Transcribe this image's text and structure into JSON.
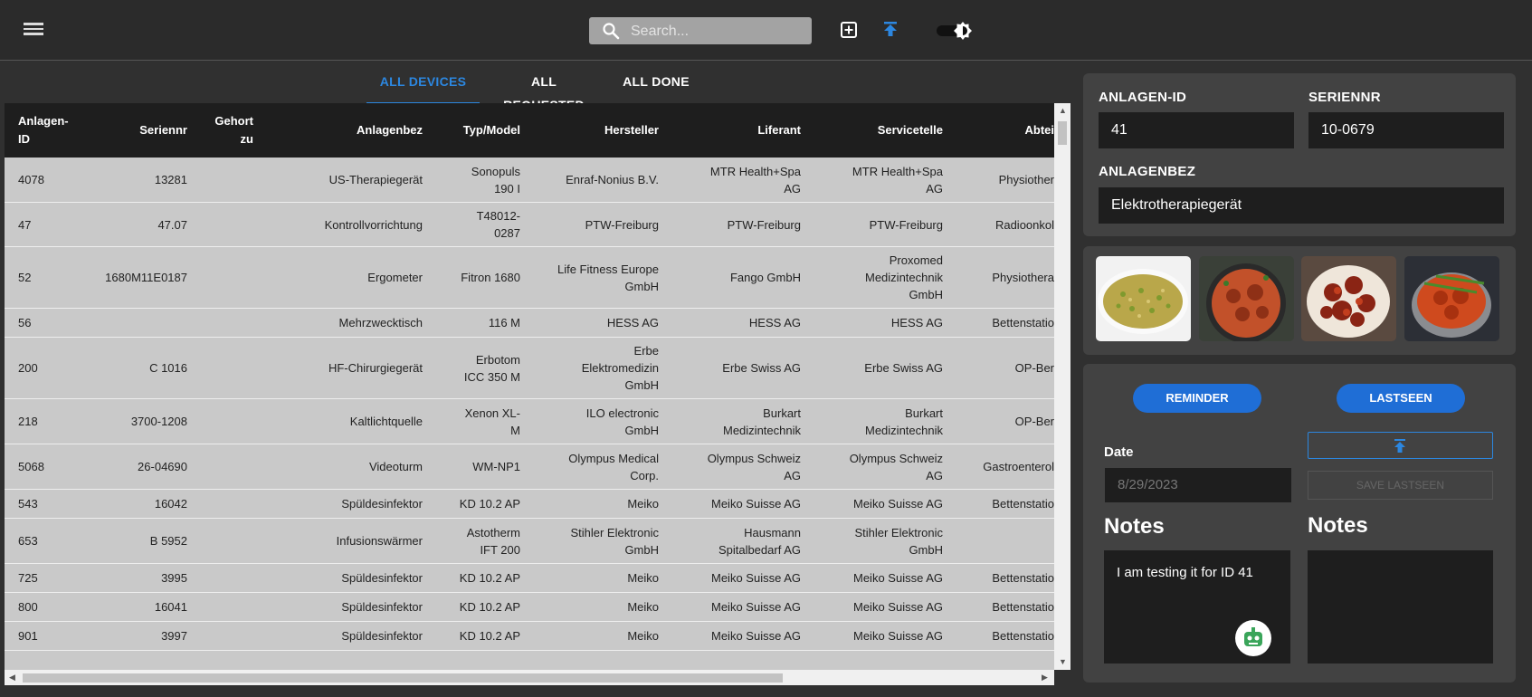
{
  "search": {
    "placeholder": "Search..."
  },
  "icons": {
    "menu": "menu-icon",
    "search": "search-icon",
    "add": "add-box-icon",
    "upload": "upload-icon",
    "theme": "theme-toggle-icon",
    "bot": "bot-icon"
  },
  "colors": {
    "accent": "#2c87e0",
    "button": "#1f6ed6",
    "topbar": "#2b2b2b",
    "panel": "#424242",
    "grid_bg": "#c9c9c9"
  },
  "tabs": [
    {
      "label": "ALL DEVICES",
      "active": true
    },
    {
      "label": "ALL REQUESTED",
      "active": false
    },
    {
      "label": "ALL DONE",
      "active": false
    }
  ],
  "table": {
    "headers": {
      "anlagen_id": [
        "Anlagen-",
        "ID"
      ],
      "seriennr": "Seriennr",
      "gehort_zu": [
        "Gehort",
        "zu"
      ],
      "anlagenbez": "Anlagenbez",
      "typ": "Typ/Model",
      "hersteller": "Hersteller",
      "liferant": "Liferant",
      "servicetelle": "Servicetelle",
      "abteilung": "Abtei"
    },
    "rows": [
      {
        "id": "4078",
        "serial": "13281",
        "bez": "US-Therapiegerät",
        "typ": [
          "Sonopuls",
          "190 I"
        ],
        "hersteller": [
          "Enraf-Nonius B.V."
        ],
        "liferant": [
          "MTR Health+Spa",
          "AG"
        ],
        "service": [
          "MTR Health+Spa",
          "AG"
        ],
        "abt": "Physiother"
      },
      {
        "id": "47",
        "serial": "47.07",
        "bez": "Kontrollvorrichtung",
        "typ": [
          "T48012-",
          "0287"
        ],
        "hersteller": [
          "PTW-Freiburg"
        ],
        "liferant": [
          "PTW-Freiburg"
        ],
        "service": [
          "PTW-Freiburg"
        ],
        "abt": "Radioonkol"
      },
      {
        "id": "52",
        "serial": "1680M11E0187",
        "bez": "Ergometer",
        "typ": [
          "Fitron 1680"
        ],
        "hersteller": [
          "Life Fitness Europe",
          "GmbH"
        ],
        "liferant": [
          "Fango GmbH"
        ],
        "service": [
          "Proxomed",
          "Medizintechnik",
          "GmbH"
        ],
        "abt": "Physiothera"
      },
      {
        "id": "56",
        "serial": "",
        "bez": "Mehrzwecktisch",
        "typ": [
          "116 M"
        ],
        "hersteller": [
          "HESS AG"
        ],
        "liferant": [
          "HESS AG"
        ],
        "service": [
          "HESS AG"
        ],
        "abt": "Bettenstatio"
      },
      {
        "id": "200",
        "serial": "C 1016",
        "bez": "HF-Chirurgiegerät",
        "typ": [
          "Erbotom",
          "ICC 350 M"
        ],
        "hersteller": [
          "Erbe",
          "Elektromedizin",
          "GmbH"
        ],
        "liferant": [
          "Erbe Swiss AG"
        ],
        "service": [
          "Erbe Swiss AG"
        ],
        "abt": "OP-Ber"
      },
      {
        "id": "218",
        "serial": "3700-1208",
        "bez": "Kaltlichtquelle",
        "typ": [
          "Xenon XL-",
          "M"
        ],
        "hersteller": [
          "ILO electronic",
          "GmbH"
        ],
        "liferant": [
          "Burkart",
          "Medizintechnik"
        ],
        "service": [
          "Burkart",
          "Medizintechnik"
        ],
        "abt": "OP-Ber"
      },
      {
        "id": "5068",
        "serial": "26-04690",
        "bez": "Videoturm",
        "typ": [
          "WM-NP1"
        ],
        "hersteller": [
          "Olympus Medical",
          "Corp."
        ],
        "liferant": [
          "Olympus Schweiz",
          "AG"
        ],
        "service": [
          "Olympus Schweiz",
          "AG"
        ],
        "abt": "Gastroenterol"
      },
      {
        "id": "543",
        "serial": "16042",
        "bez": "Spüldesinfektor",
        "typ": [
          "KD 10.2 AP"
        ],
        "hersteller": [
          "Meiko"
        ],
        "liferant": [
          "Meiko Suisse AG"
        ],
        "service": [
          "Meiko Suisse AG"
        ],
        "abt": "Bettenstatio"
      },
      {
        "id": "653",
        "serial": "B 5952",
        "bez": "Infusionswärmer",
        "typ": [
          "Astotherm",
          "IFT 200"
        ],
        "hersteller": [
          "Stihler Elektronic",
          "GmbH"
        ],
        "liferant": [
          "Hausmann",
          "Spitalbedarf AG"
        ],
        "service": [
          "Stihler Elektronic",
          "GmbH"
        ],
        "abt": ""
      },
      {
        "id": "725",
        "serial": "3995",
        "bez": "Spüldesinfektor",
        "typ": [
          "KD 10.2 AP"
        ],
        "hersteller": [
          "Meiko"
        ],
        "liferant": [
          "Meiko Suisse AG"
        ],
        "service": [
          "Meiko Suisse AG"
        ],
        "abt": "Bettenstatio"
      },
      {
        "id": "800",
        "serial": "16041",
        "bez": "Spüldesinfektor",
        "typ": [
          "KD 10.2 AP"
        ],
        "hersteller": [
          "Meiko"
        ],
        "liferant": [
          "Meiko Suisse AG"
        ],
        "service": [
          "Meiko Suisse AG"
        ],
        "abt": "Bettenstatio"
      },
      {
        "id": "901",
        "serial": "3997",
        "bez": "Spüldesinfektor",
        "typ": [
          "KD 10.2 AP"
        ],
        "hersteller": [
          "Meiko"
        ],
        "liferant": [
          "Meiko Suisse AG"
        ],
        "service": [
          "Meiko Suisse AG"
        ],
        "abt": "Bettenstatio"
      }
    ]
  },
  "detail": {
    "anlagen_id_label": "ANLAGEN-ID",
    "anlagen_id_value": "41",
    "seriennr_label": "SERIENNR",
    "seriennr_value": "10-0679",
    "anlagenbez_label": "ANLAGENBEZ",
    "anlagenbez_value": "Elektrotherapiegerät"
  },
  "actions": {
    "reminder_label": "REMINDER",
    "lastseen_label": "LASTSEEN",
    "date_label": "Date",
    "date_placeholder": "8/29/2023",
    "save_lastseen_label": "SAVE LASTSEEN",
    "notes_left_heading": "Notes",
    "notes_right_heading": "Notes",
    "notes_left_text": "I am testing it for ID 41",
    "notes_right_text": ""
  }
}
